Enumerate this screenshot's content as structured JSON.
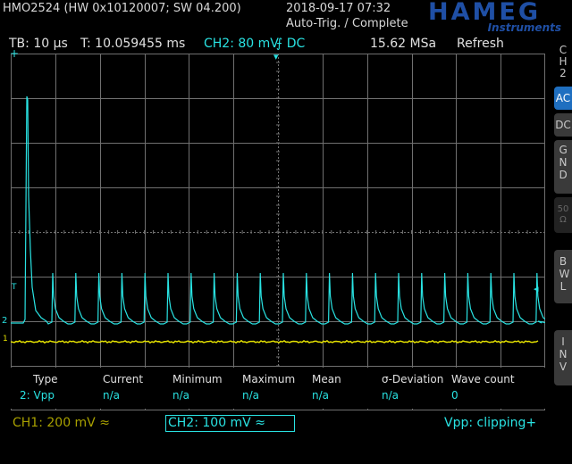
{
  "header": {
    "model": "HMO2524 (HW 0x10120007; SW 04.200)",
    "datetime": "2018-09-17 07:32",
    "trigger_status": "Auto-Trig. / Complete",
    "logo": "HAMEG",
    "logo_sub": "Instruments"
  },
  "status": {
    "timebase": "TB: 10 µs",
    "time": "T: 10.059455 ms",
    "channel": "CH2: 80 mV",
    "slope_coupling": "⨍ DC",
    "sample_rate": "15.62 MSa",
    "mode": "Refresh"
  },
  "side_panel": {
    "channel_label": [
      "C",
      "H",
      "2"
    ],
    "buttons": [
      {
        "label": "AC",
        "active": true
      },
      {
        "label": "DC",
        "active": false
      },
      {
        "label": "G N D",
        "active": false
      },
      {
        "label": "50 Ω",
        "active": false,
        "disabled": true
      },
      {
        "label": "B W L",
        "active": false
      },
      {
        "label": "I N V",
        "active": false
      }
    ]
  },
  "measurements": {
    "headers": [
      "Type",
      "Current",
      "Minimum",
      "Maximum",
      "Mean",
      "σ-Deviation",
      "Wave count"
    ],
    "row": [
      "2: Vpp",
      "n/a",
      "n/a",
      "n/a",
      "n/a",
      "n/a",
      "0"
    ]
  },
  "bottom": {
    "ch1": "CH1: 200 mV ≈",
    "ch2": "CH2: 100 mV ≈",
    "info": "Vpp: clipping+"
  },
  "markers": {
    "ch2_ref": "2",
    "ch1_ref": "1",
    "trigger_level": "T",
    "trigger_right": "◂",
    "trigger_top": "▾",
    "top_left": "+"
  },
  "colors": {
    "ch1": "#e3e000",
    "ch2": "#29e3e3",
    "grid": "#707070",
    "accent": "#1f6fc0"
  }
}
